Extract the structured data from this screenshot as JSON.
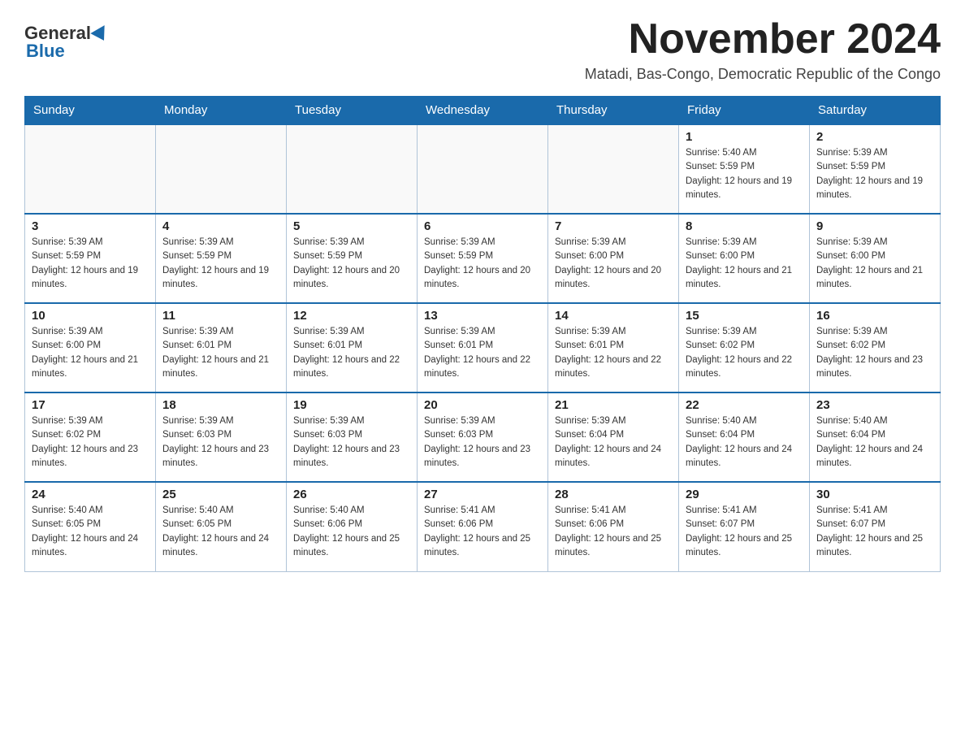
{
  "logo": {
    "general": "General",
    "blue": "Blue"
  },
  "title": "November 2024",
  "subtitle": "Matadi, Bas-Congo, Democratic Republic of the Congo",
  "days_of_week": [
    "Sunday",
    "Monday",
    "Tuesday",
    "Wednesday",
    "Thursday",
    "Friday",
    "Saturday"
  ],
  "weeks": [
    [
      {
        "day": "",
        "sunrise": "",
        "sunset": "",
        "daylight": ""
      },
      {
        "day": "",
        "sunrise": "",
        "sunset": "",
        "daylight": ""
      },
      {
        "day": "",
        "sunrise": "",
        "sunset": "",
        "daylight": ""
      },
      {
        "day": "",
        "sunrise": "",
        "sunset": "",
        "daylight": ""
      },
      {
        "day": "",
        "sunrise": "",
        "sunset": "",
        "daylight": ""
      },
      {
        "day": "1",
        "sunrise": "Sunrise: 5:40 AM",
        "sunset": "Sunset: 5:59 PM",
        "daylight": "Daylight: 12 hours and 19 minutes."
      },
      {
        "day": "2",
        "sunrise": "Sunrise: 5:39 AM",
        "sunset": "Sunset: 5:59 PM",
        "daylight": "Daylight: 12 hours and 19 minutes."
      }
    ],
    [
      {
        "day": "3",
        "sunrise": "Sunrise: 5:39 AM",
        "sunset": "Sunset: 5:59 PM",
        "daylight": "Daylight: 12 hours and 19 minutes."
      },
      {
        "day": "4",
        "sunrise": "Sunrise: 5:39 AM",
        "sunset": "Sunset: 5:59 PM",
        "daylight": "Daylight: 12 hours and 19 minutes."
      },
      {
        "day": "5",
        "sunrise": "Sunrise: 5:39 AM",
        "sunset": "Sunset: 5:59 PM",
        "daylight": "Daylight: 12 hours and 20 minutes."
      },
      {
        "day": "6",
        "sunrise": "Sunrise: 5:39 AM",
        "sunset": "Sunset: 5:59 PM",
        "daylight": "Daylight: 12 hours and 20 minutes."
      },
      {
        "day": "7",
        "sunrise": "Sunrise: 5:39 AM",
        "sunset": "Sunset: 6:00 PM",
        "daylight": "Daylight: 12 hours and 20 minutes."
      },
      {
        "day": "8",
        "sunrise": "Sunrise: 5:39 AM",
        "sunset": "Sunset: 6:00 PM",
        "daylight": "Daylight: 12 hours and 21 minutes."
      },
      {
        "day": "9",
        "sunrise": "Sunrise: 5:39 AM",
        "sunset": "Sunset: 6:00 PM",
        "daylight": "Daylight: 12 hours and 21 minutes."
      }
    ],
    [
      {
        "day": "10",
        "sunrise": "Sunrise: 5:39 AM",
        "sunset": "Sunset: 6:00 PM",
        "daylight": "Daylight: 12 hours and 21 minutes."
      },
      {
        "day": "11",
        "sunrise": "Sunrise: 5:39 AM",
        "sunset": "Sunset: 6:01 PM",
        "daylight": "Daylight: 12 hours and 21 minutes."
      },
      {
        "day": "12",
        "sunrise": "Sunrise: 5:39 AM",
        "sunset": "Sunset: 6:01 PM",
        "daylight": "Daylight: 12 hours and 22 minutes."
      },
      {
        "day": "13",
        "sunrise": "Sunrise: 5:39 AM",
        "sunset": "Sunset: 6:01 PM",
        "daylight": "Daylight: 12 hours and 22 minutes."
      },
      {
        "day": "14",
        "sunrise": "Sunrise: 5:39 AM",
        "sunset": "Sunset: 6:01 PM",
        "daylight": "Daylight: 12 hours and 22 minutes."
      },
      {
        "day": "15",
        "sunrise": "Sunrise: 5:39 AM",
        "sunset": "Sunset: 6:02 PM",
        "daylight": "Daylight: 12 hours and 22 minutes."
      },
      {
        "day": "16",
        "sunrise": "Sunrise: 5:39 AM",
        "sunset": "Sunset: 6:02 PM",
        "daylight": "Daylight: 12 hours and 23 minutes."
      }
    ],
    [
      {
        "day": "17",
        "sunrise": "Sunrise: 5:39 AM",
        "sunset": "Sunset: 6:02 PM",
        "daylight": "Daylight: 12 hours and 23 minutes."
      },
      {
        "day": "18",
        "sunrise": "Sunrise: 5:39 AM",
        "sunset": "Sunset: 6:03 PM",
        "daylight": "Daylight: 12 hours and 23 minutes."
      },
      {
        "day": "19",
        "sunrise": "Sunrise: 5:39 AM",
        "sunset": "Sunset: 6:03 PM",
        "daylight": "Daylight: 12 hours and 23 minutes."
      },
      {
        "day": "20",
        "sunrise": "Sunrise: 5:39 AM",
        "sunset": "Sunset: 6:03 PM",
        "daylight": "Daylight: 12 hours and 23 minutes."
      },
      {
        "day": "21",
        "sunrise": "Sunrise: 5:39 AM",
        "sunset": "Sunset: 6:04 PM",
        "daylight": "Daylight: 12 hours and 24 minutes."
      },
      {
        "day": "22",
        "sunrise": "Sunrise: 5:40 AM",
        "sunset": "Sunset: 6:04 PM",
        "daylight": "Daylight: 12 hours and 24 minutes."
      },
      {
        "day": "23",
        "sunrise": "Sunrise: 5:40 AM",
        "sunset": "Sunset: 6:04 PM",
        "daylight": "Daylight: 12 hours and 24 minutes."
      }
    ],
    [
      {
        "day": "24",
        "sunrise": "Sunrise: 5:40 AM",
        "sunset": "Sunset: 6:05 PM",
        "daylight": "Daylight: 12 hours and 24 minutes."
      },
      {
        "day": "25",
        "sunrise": "Sunrise: 5:40 AM",
        "sunset": "Sunset: 6:05 PM",
        "daylight": "Daylight: 12 hours and 24 minutes."
      },
      {
        "day": "26",
        "sunrise": "Sunrise: 5:40 AM",
        "sunset": "Sunset: 6:06 PM",
        "daylight": "Daylight: 12 hours and 25 minutes."
      },
      {
        "day": "27",
        "sunrise": "Sunrise: 5:41 AM",
        "sunset": "Sunset: 6:06 PM",
        "daylight": "Daylight: 12 hours and 25 minutes."
      },
      {
        "day": "28",
        "sunrise": "Sunrise: 5:41 AM",
        "sunset": "Sunset: 6:06 PM",
        "daylight": "Daylight: 12 hours and 25 minutes."
      },
      {
        "day": "29",
        "sunrise": "Sunrise: 5:41 AM",
        "sunset": "Sunset: 6:07 PM",
        "daylight": "Daylight: 12 hours and 25 minutes."
      },
      {
        "day": "30",
        "sunrise": "Sunrise: 5:41 AM",
        "sunset": "Sunset: 6:07 PM",
        "daylight": "Daylight: 12 hours and 25 minutes."
      }
    ]
  ]
}
